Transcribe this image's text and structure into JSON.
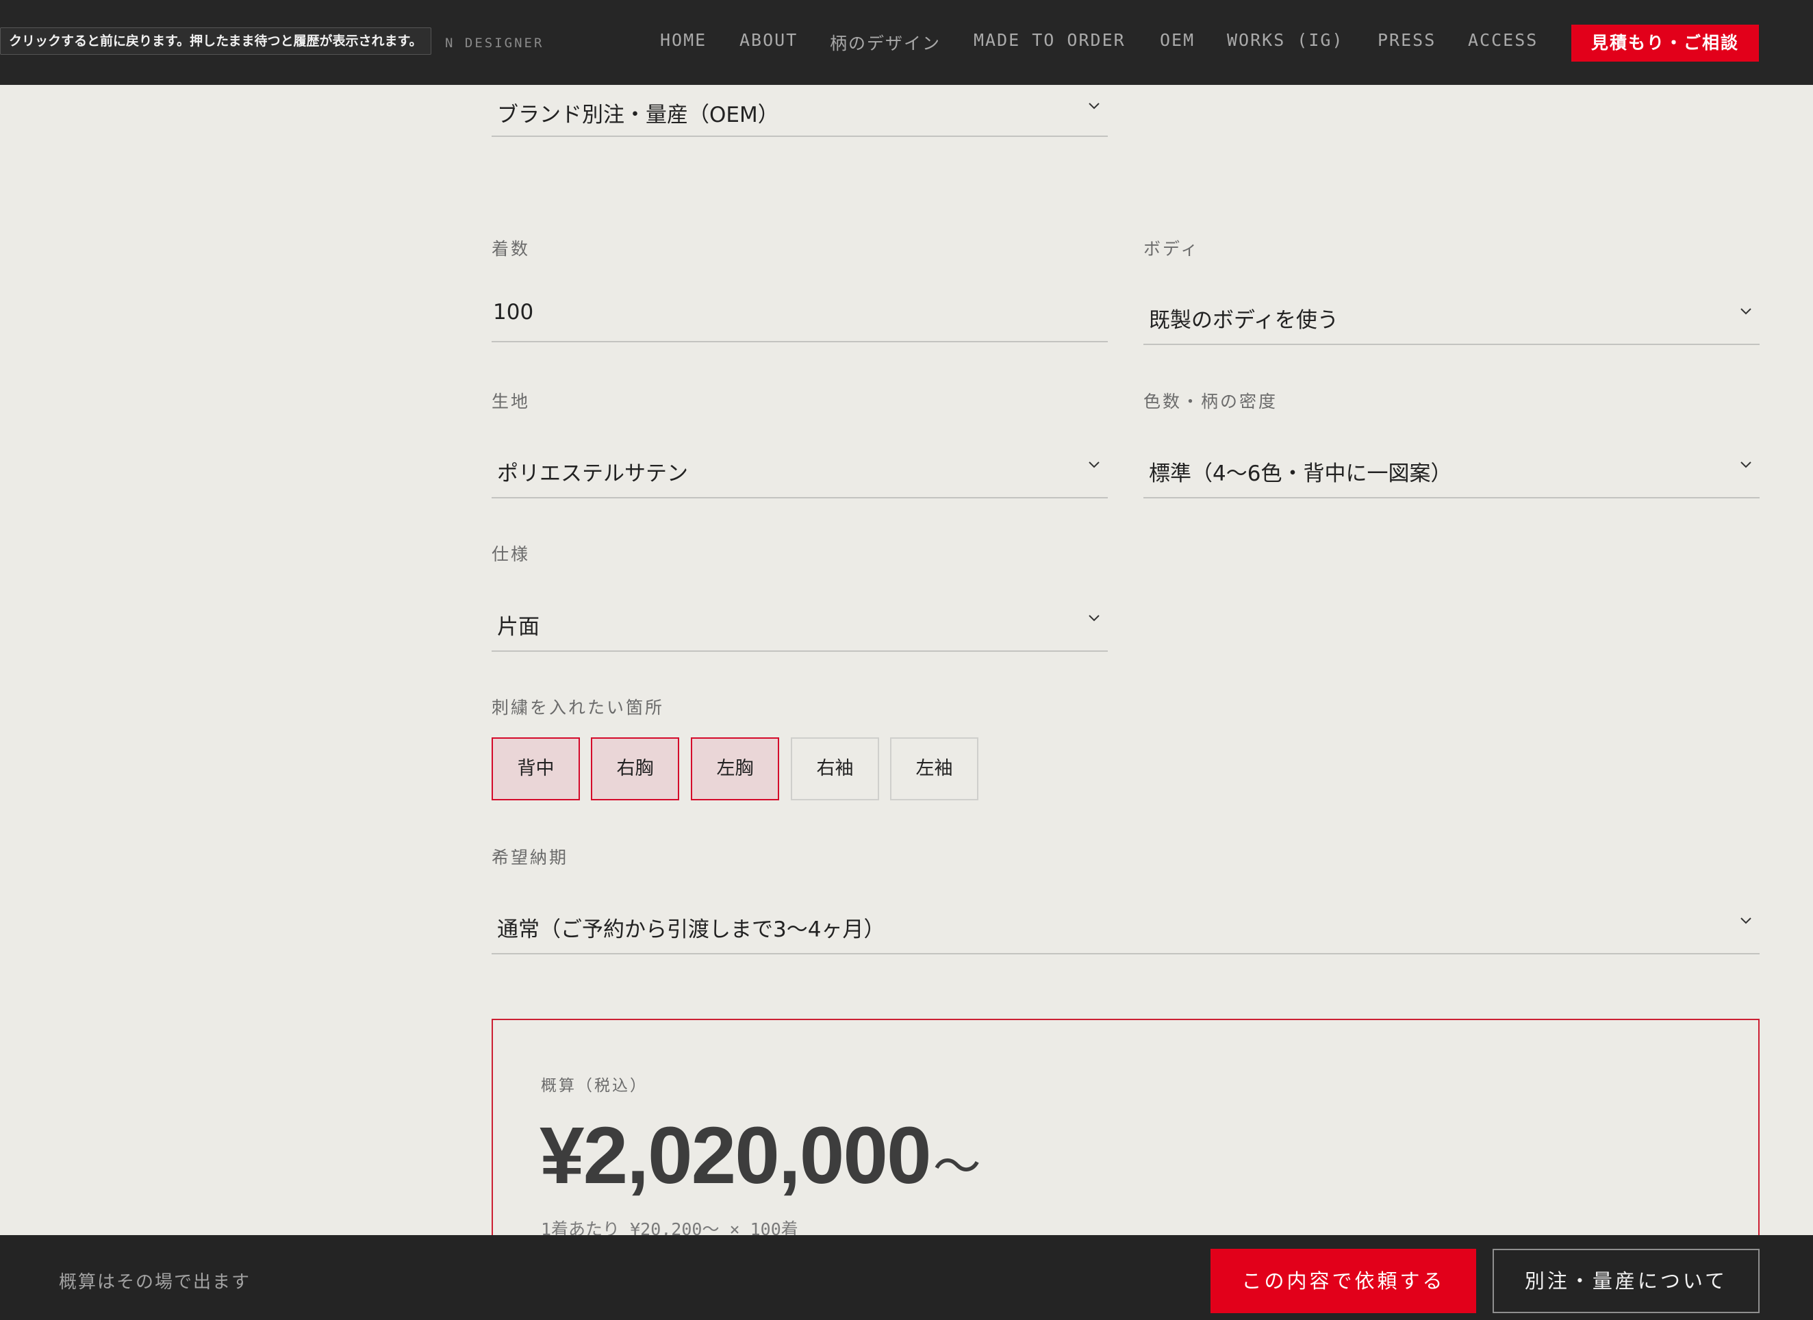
{
  "tooltip": "クリックすると前に戻ります。押したまま待つと履歴が表示されます。",
  "header": {
    "brand_fragment": "N DESIGNER",
    "nav": [
      {
        "label": "HOME"
      },
      {
        "label": "ABOUT"
      },
      {
        "label": "柄のデザイン"
      },
      {
        "label": "MADE TO ORDER"
      },
      {
        "label": "OEM"
      },
      {
        "label": "WORKS (IG)"
      },
      {
        "label": "PRESS"
      },
      {
        "label": "ACCESS"
      }
    ],
    "cta": "見積もり・ご相談"
  },
  "form": {
    "order_type": {
      "value": "ブランド別注・量産（OEM）"
    },
    "quantity": {
      "label": "着数",
      "value": "100"
    },
    "body": {
      "label": "ボディ",
      "value": "既製のボディを使う"
    },
    "fabric": {
      "label": "生地",
      "value": "ポリエステルサテン"
    },
    "colors": {
      "label": "色数・柄の密度",
      "value": "標準（4〜6色・背中に一図案）"
    },
    "spec": {
      "label": "仕様",
      "value": "片面"
    },
    "embroidery": {
      "label": "刺繍を入れたい箇所",
      "options": [
        {
          "label": "背中",
          "selected": true
        },
        {
          "label": "右胸",
          "selected": true
        },
        {
          "label": "左胸",
          "selected": true
        },
        {
          "label": "右袖",
          "selected": false
        },
        {
          "label": "左袖",
          "selected": false
        }
      ]
    },
    "delivery": {
      "label": "希望納期",
      "value": "通常（ご予約から引渡しまで3〜4ヶ月）"
    }
  },
  "estimate": {
    "label": "概算（税込）",
    "amount": "¥2,020,000",
    "suffix": "〜",
    "detail": "1着あたり ¥20,200〜 × 100着"
  },
  "footer": {
    "note": "概算はその場で出ます",
    "submit": "この内容で依頼する",
    "about": "別注・量産について"
  },
  "colors": {
    "accent": "#e2001a",
    "chip_active_bg": "#ead6d7",
    "chip_active_border": "#d40a2a",
    "page_bg": "#ecebe6",
    "bar_bg": "#262626"
  }
}
